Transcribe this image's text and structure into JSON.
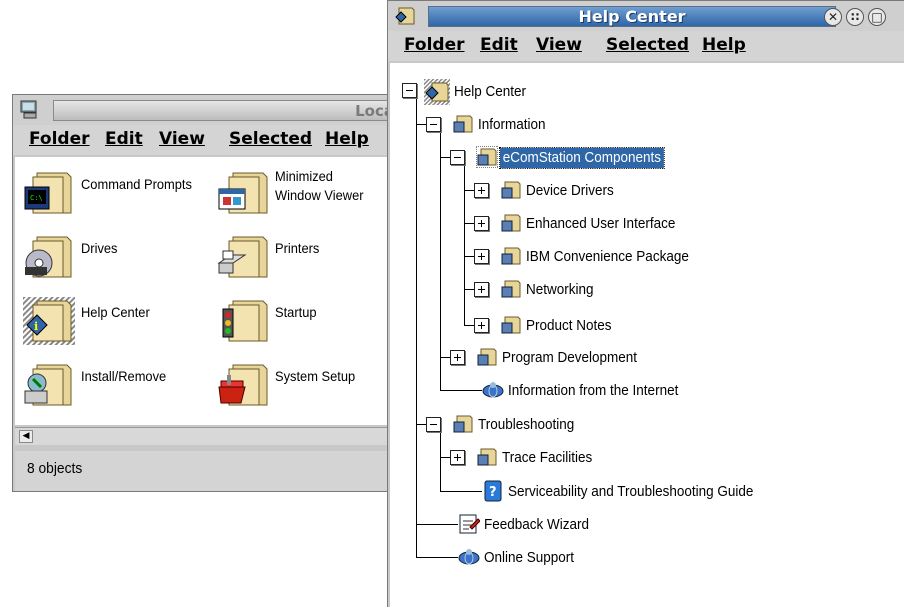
{
  "folder_window": {
    "title": "Loca",
    "menu": [
      "Folder",
      "Edit",
      "View",
      "Selected",
      "Help"
    ],
    "items": [
      {
        "label": "Command Prompts",
        "icon": "command-prompt-folder-icon"
      },
      {
        "label": "Minimized\nWindow Viewer",
        "icon": "window-viewer-folder-icon"
      },
      {
        "label": "Drives",
        "icon": "drives-folder-icon"
      },
      {
        "label": "Printers",
        "icon": "printers-folder-icon"
      },
      {
        "label": "Help Center",
        "icon": "help-center-folder-icon"
      },
      {
        "label": "Startup",
        "icon": "startup-folder-icon"
      },
      {
        "label": "Install/Remove",
        "icon": "install-remove-folder-icon"
      },
      {
        "label": "System Setup",
        "icon": "system-setup-folder-icon"
      }
    ],
    "status": "8 objects"
  },
  "help_window": {
    "title": "Help Center",
    "menu": [
      "Folder",
      "Edit",
      "View",
      "Selected",
      "Help"
    ],
    "tree": {
      "root": "Help Center",
      "information": "Information",
      "ecs_components": "eComStation Components",
      "device_drivers": "Device Drivers",
      "enhanced_ui": "Enhanced User Interface",
      "ibm_convenience": "IBM Convenience Package",
      "networking": "Networking",
      "product_notes": "Product Notes",
      "program_development": "Program Development",
      "info_internet": "Information from the Internet",
      "troubleshooting": "Troubleshooting",
      "trace_facilities": "Trace Facilities",
      "serviceability_guide": "Serviceability and Troubleshooting Guide",
      "feedback_wizard": "Feedback Wizard",
      "online_support": "Online Support"
    }
  },
  "colors": {
    "active_title": "#2f66a8",
    "selection": "#2f66a8",
    "folder": "#e8d59a"
  }
}
